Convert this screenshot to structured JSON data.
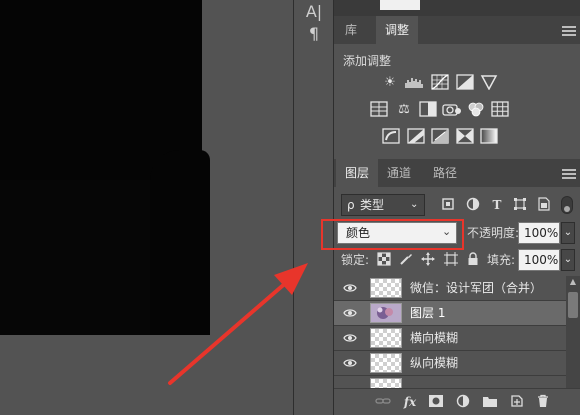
{
  "tool_strip": {
    "type_tool_glyph": "A|",
    "paragraph_glyph": "¶"
  },
  "panel_top": {
    "tabs": [
      {
        "label": "库"
      },
      {
        "label": "调整"
      }
    ]
  },
  "adjustments": {
    "title": "添加调整",
    "row1": [
      "brightness-contrast-icon",
      "levels-icon",
      "curves-icon",
      "exposure-icon",
      "vibrance-icon"
    ],
    "row2": [
      "hue-saturation-icon",
      "color-balance-icon",
      "black-white-icon",
      "photo-filter-icon",
      "channel-mixer-icon",
      "color-lookup-icon"
    ],
    "row3": [
      "invert-icon",
      "posterize-icon",
      "threshold-icon",
      "selective-color-icon",
      "gradient-map-icon"
    ]
  },
  "layers_panel": {
    "tabs": [
      {
        "label": "图层"
      },
      {
        "label": "通道"
      },
      {
        "label": "路径"
      }
    ],
    "filter": {
      "label": "类型",
      "search_glyph": "ρ"
    },
    "blend_mode": {
      "value": "颜色"
    },
    "opacity": {
      "label": "不透明度:",
      "value": "100%"
    },
    "lock": {
      "label": "锁定:"
    },
    "fill": {
      "label": "填充:",
      "value": "100%"
    },
    "layers": [
      {
        "name": "微信：设计军团（合并）",
        "selected": false
      },
      {
        "name": "图层 1",
        "selected": true
      },
      {
        "name": "横向模糊",
        "selected": false
      },
      {
        "name": "纵向模糊",
        "selected": false
      }
    ]
  },
  "colors": {
    "panel_bg": "#535353",
    "tab_bg": "#424242",
    "selected_row": "#6a6a6a",
    "highlight": "#e8352b"
  }
}
